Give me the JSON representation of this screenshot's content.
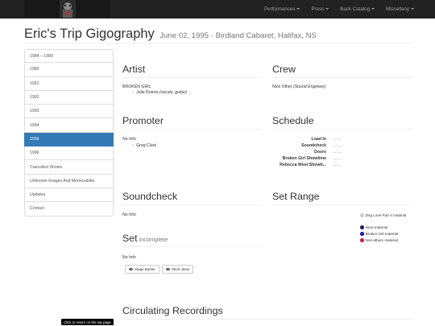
{
  "nav": {
    "items": [
      {
        "label": "Performances"
      },
      {
        "label": "Press"
      },
      {
        "label": "Back Catalog"
      },
      {
        "label": "Miscellany"
      }
    ]
  },
  "header": {
    "title": "Eric's Trip Gigography",
    "subtitle": "June 02, 1995 - Birdland Cabaret, Halifax, NS"
  },
  "sidebar": {
    "active_index": 6,
    "items": [
      {
        "label": "1984 – 1989"
      },
      {
        "label": "1990"
      },
      {
        "label": "1991"
      },
      {
        "label": "1992"
      },
      {
        "label": "1993"
      },
      {
        "label": "1994"
      },
      {
        "label": "1995"
      },
      {
        "label": "1996"
      },
      {
        "label": "Cancelled Shows"
      },
      {
        "label": "Unknown Images And Memorabilia"
      },
      {
        "label": "Updates"
      },
      {
        "label": "Contact"
      }
    ]
  },
  "artist": {
    "heading": "Artist",
    "name": "BROKEN GIRL",
    "members": [
      {
        "name": "Julie Doiron",
        "role": "(vocals, guitar)"
      }
    ]
  },
  "crew": {
    "heading": "Crew",
    "entries": [
      {
        "name": "Nick Other",
        "role": "(Sound Engineer)"
      }
    ]
  },
  "promoter": {
    "heading": "Promoter",
    "info": "No Info",
    "people": [
      "Greg Clark"
    ]
  },
  "schedule": {
    "heading": "Schedule",
    "rows": [
      {
        "label": "Load In",
        "value": "...:...."
      },
      {
        "label": "Soundcheck",
        "value": "...:...."
      },
      {
        "label": "Doors",
        "value": "...:...."
      },
      {
        "label": "Broken Girl Showtime",
        "value": "...:...."
      },
      {
        "label": "Rebecca West Showti...",
        "value": "...:...."
      }
    ]
  },
  "soundcheck": {
    "heading": "Soundcheck",
    "info": "No Info"
  },
  "set_range": {
    "heading": "Set Range",
    "legend": [
      {
        "label": "Dog Love Part II material",
        "color": "#cccccc"
      },
      {
        "label": "Nora material",
        "color": "#2e1a66"
      },
      {
        "label": "Broken Girl material",
        "color": "#1a1aaa"
      },
      {
        "label": "Non-album material",
        "color": "#cc1a4d"
      }
    ]
  },
  "set": {
    "heading": "Set",
    "status": "incomplete",
    "info": "No Info",
    "buttons": [
      {
        "label": "Stage Banter"
      },
      {
        "label": "Short Jams"
      }
    ]
  },
  "recordings": {
    "heading": "Circulating Recordings"
  },
  "tooltip": {
    "text": "Click to return on the top page"
  }
}
